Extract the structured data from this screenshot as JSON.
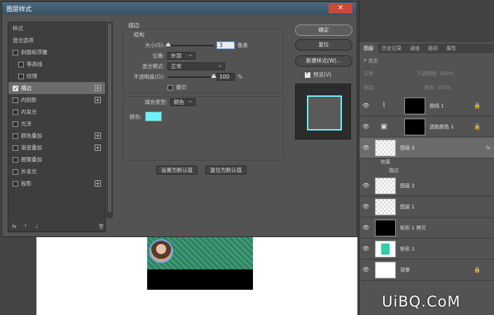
{
  "dialog": {
    "title": "图层样式",
    "close_glyph": "✕",
    "style_list": [
      {
        "label": "样式",
        "check": false,
        "plus": false,
        "sub": false,
        "selected": false
      },
      {
        "label": "混合选项",
        "check": false,
        "plus": false,
        "sub": false,
        "selected": false
      },
      {
        "label": "斜面和浮雕",
        "check": true,
        "checked": false,
        "plus": false,
        "sub": false,
        "selected": false
      },
      {
        "label": "等高线",
        "check": true,
        "checked": false,
        "plus": false,
        "sub": true,
        "selected": false
      },
      {
        "label": "纹理",
        "check": true,
        "checked": false,
        "plus": false,
        "sub": true,
        "selected": false
      },
      {
        "label": "描边",
        "check": true,
        "checked": true,
        "plus": true,
        "sub": false,
        "selected": true
      },
      {
        "label": "内阴影",
        "check": true,
        "checked": false,
        "plus": true,
        "sub": false,
        "selected": false
      },
      {
        "label": "内发光",
        "check": true,
        "checked": false,
        "plus": false,
        "sub": false,
        "selected": false
      },
      {
        "label": "光泽",
        "check": true,
        "checked": false,
        "plus": false,
        "sub": false,
        "selected": false
      },
      {
        "label": "颜色叠加",
        "check": true,
        "checked": false,
        "plus": true,
        "sub": false,
        "selected": false
      },
      {
        "label": "渐变叠加",
        "check": true,
        "checked": false,
        "plus": true,
        "sub": false,
        "selected": false
      },
      {
        "label": "图案叠加",
        "check": true,
        "checked": false,
        "plus": false,
        "sub": false,
        "selected": false
      },
      {
        "label": "外发光",
        "check": true,
        "checked": false,
        "plus": false,
        "sub": false,
        "selected": false
      },
      {
        "label": "投影",
        "check": true,
        "checked": false,
        "plus": true,
        "sub": false,
        "selected": false
      }
    ],
    "footer": {
      "fx": "fx",
      "up": "⇡",
      "down": "⇣",
      "trash": "🗑"
    },
    "stroke": {
      "section_title": "描边",
      "structure_title": "结构",
      "size_label": "大小(S):",
      "size_value": "3",
      "size_unit": "像素",
      "size_fraction": 0.02,
      "position_label": "位置:",
      "position_value": "外部",
      "blend_label": "混合模式:",
      "blend_value": "正常",
      "opacity_label": "不透明度(O):",
      "opacity_value": "100",
      "opacity_unit": "%",
      "opacity_fraction": 1.0,
      "emboss_label": "叠印",
      "fill_type_label": "填充类型:",
      "fill_type_value": "颜色",
      "color_label": "颜色:",
      "color_hex": "#6df4fa",
      "set_default": "设置为默认值",
      "reset_default": "复位为默认值"
    },
    "buttons": {
      "ok": "确定",
      "reset": "复位",
      "new_style": "新建样式(W)...",
      "preview_label": "预览(V)"
    }
  },
  "panel": {
    "tabs": [
      "图层",
      "历史记录",
      "通道",
      "路径",
      "属性"
    ],
    "filter_label": "P 类型",
    "blend_mode": "正常",
    "opacity_label": "不透明度: 100%",
    "lock_label": "锁定:",
    "fill_label": "填充: 100%",
    "layers": [
      {
        "name": "曲线 1",
        "thumb": "black",
        "icon": "curves-icon",
        "glyph": "⌇",
        "lock": true,
        "selected": false
      },
      {
        "name": "选取颜色 1",
        "thumb": "black",
        "icon": "selective-color-icon",
        "glyph": "▣",
        "lock": true,
        "selected": false
      },
      {
        "name": "图层 3",
        "thumb": "checker",
        "icon": "",
        "glyph": "",
        "lock": false,
        "selected": true,
        "fx": "fx"
      },
      {
        "name": "图层 2",
        "thumb": "checker",
        "icon": "",
        "glyph": "",
        "lock": false,
        "selected": false
      },
      {
        "name": "图层 1",
        "thumb": "checker",
        "icon": "",
        "glyph": "",
        "lock": false,
        "selected": false
      },
      {
        "name": "矩形 1 拷贝",
        "thumb": "black",
        "icon": "",
        "glyph": "",
        "lock": false,
        "selected": false
      },
      {
        "name": "矩形 1",
        "thumb": "teal",
        "icon": "",
        "glyph": "",
        "lock": false,
        "selected": false
      },
      {
        "name": "背景",
        "thumb": "white",
        "icon": "",
        "glyph": "",
        "lock": true,
        "selected": false
      }
    ],
    "effects_label": "效果",
    "stroke_effect_label": "描边"
  },
  "watermark": "UiBQ.CoM"
}
